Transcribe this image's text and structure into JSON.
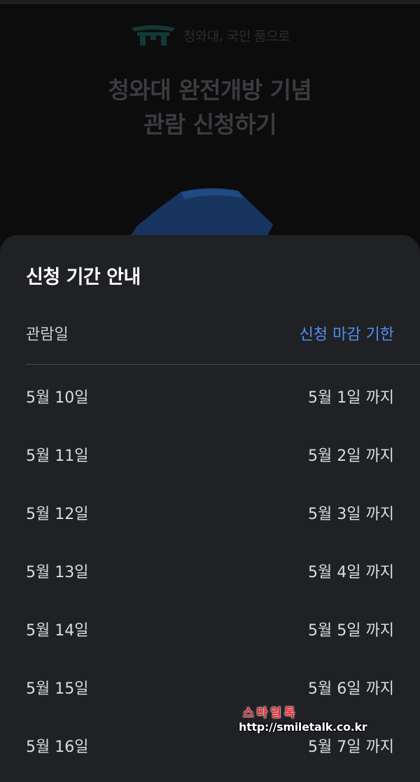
{
  "background": {
    "logo_text": "청와대, 국민 품으로",
    "title_lines": [
      "청와대 완전개방 기념",
      "관람 신청하기"
    ]
  },
  "sheet": {
    "title": "신청 기간 안내",
    "header": {
      "left": "관람일",
      "right": "신청 마감 기한"
    },
    "rows": [
      {
        "date": "5월 10일",
        "deadline": "5월 1일 까지"
      },
      {
        "date": "5월 11일",
        "deadline": "5월 2일 까지"
      },
      {
        "date": "5월 12일",
        "deadline": "5월 3일 까지"
      },
      {
        "date": "5월 13일",
        "deadline": "5월 4일 까지"
      },
      {
        "date": "5월 14일",
        "deadline": "5월 5일 까지"
      },
      {
        "date": "5월 15일",
        "deadline": "5월 6일 까지"
      },
      {
        "date": "5월 16일",
        "deadline": "5월 7일 까지"
      }
    ]
  },
  "watermark": {
    "brand": "스마일톡",
    "url": "http://smiletalk.co.kr"
  },
  "colors": {
    "accent": "#4f8ff2",
    "sheet_bg": "#202125",
    "page_bg": "#0c0c0d",
    "watermark_red": "#e8232a"
  }
}
